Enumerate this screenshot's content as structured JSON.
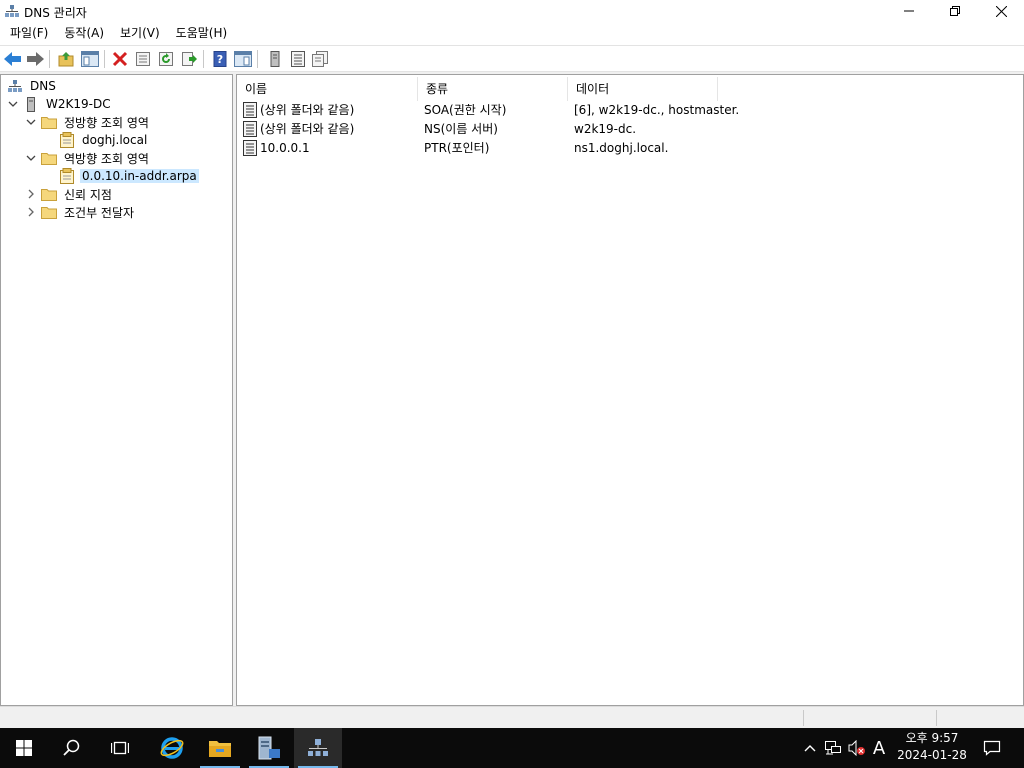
{
  "window": {
    "title": "DNS 관리자",
    "minimize_icon": "minimize-icon",
    "restore_icon": "restore-icon",
    "close_icon": "close-icon"
  },
  "menu": [
    "파일(F)",
    "동작(A)",
    "보기(V)",
    "도움말(H)"
  ],
  "toolbar": {
    "icons": [
      "back-icon",
      "forward-icon",
      "up-folder-icon",
      "show-hide-tree-icon",
      "delete-icon",
      "properties-icon",
      "refresh-icon",
      "export-list-icon",
      "help-icon",
      "show-hide-action-pane-icon",
      "server-icon",
      "zone-records-icon",
      "records-copy-icon"
    ]
  },
  "tree": {
    "root": "DNS",
    "server": "W2K19-DC",
    "forward_zones": "정방향 조회 영역",
    "forward_zone_1": "doghj.local",
    "reverse_zones": "역방향 조회 영역",
    "reverse_zone_1": "0.0.10.in-addr.arpa",
    "trust_points": "신뢰 지점",
    "conditional_forwarders": "조건부 전달자"
  },
  "list": {
    "columns": [
      "이름",
      "종류",
      "데이터"
    ],
    "rows": [
      {
        "name": "(상위 폴더와 같음)",
        "type": "SOA(권한 시작)",
        "data": "[6], w2k19-dc., hostmaster."
      },
      {
        "name": "(상위 폴더와 같음)",
        "type": "NS(이름 서버)",
        "data": "w2k19-dc."
      },
      {
        "name": "10.0.0.1",
        "type": "PTR(포인터)",
        "data": "ns1.doghj.local."
      }
    ]
  },
  "taskbar": {
    "items": [
      "start-icon",
      "search-icon",
      "task-view-icon",
      "internet-explorer-icon",
      "file-explorer-icon",
      "server-manager-icon",
      "dns-manager-icon"
    ],
    "tray": {
      "ime": "A",
      "time": "오후 9:57",
      "date": "2024-01-28"
    }
  },
  "colors": {
    "selection": "#cce8ff",
    "taskbar_bg": "#0b0b0b",
    "accent": "#76b9ed"
  }
}
